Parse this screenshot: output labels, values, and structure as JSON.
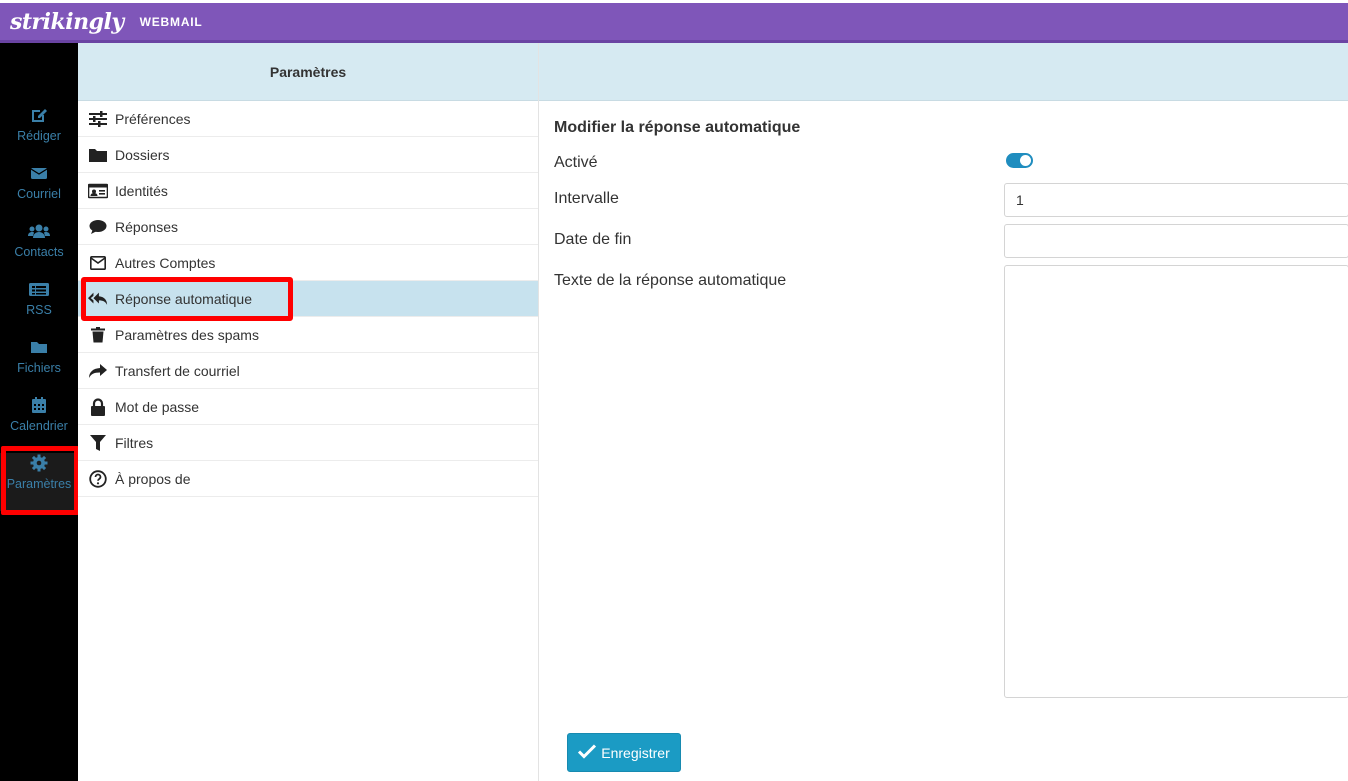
{
  "topbar": {
    "logo": "strikingly",
    "product": "WEBMAIL"
  },
  "nav": {
    "items": [
      {
        "label": "Rédiger",
        "icon": "compose-icon"
      },
      {
        "label": "Courriel",
        "icon": "envelope-icon"
      },
      {
        "label": "Contacts",
        "icon": "users-icon"
      },
      {
        "label": "RSS",
        "icon": "rss-list-icon"
      },
      {
        "label": "Fichiers",
        "icon": "folder-icon"
      },
      {
        "label": "Calendrier",
        "icon": "calendar-icon"
      },
      {
        "label": "Paramètres",
        "icon": "gear-icon"
      }
    ]
  },
  "settings": {
    "header": "Paramètres",
    "items": [
      {
        "label": "Préférences",
        "icon": "sliders-icon"
      },
      {
        "label": "Dossiers",
        "icon": "folder-icon"
      },
      {
        "label": "Identités",
        "icon": "id-card-icon"
      },
      {
        "label": "Réponses",
        "icon": "comment-icon"
      },
      {
        "label": "Autres Comptes",
        "icon": "envelope-square-icon"
      },
      {
        "label": "Réponse automatique",
        "icon": "reply-all-icon"
      },
      {
        "label": "Paramètres des spams",
        "icon": "trash-icon"
      },
      {
        "label": "Transfert de courriel",
        "icon": "share-icon"
      },
      {
        "label": "Mot de passe",
        "icon": "lock-icon"
      },
      {
        "label": "Filtres",
        "icon": "filter-icon"
      },
      {
        "label": "À propos de",
        "icon": "question-circle-icon"
      }
    ],
    "selected_index": 5
  },
  "form": {
    "title": "Modifier la réponse automatique",
    "active_label": "Activé",
    "active_value": true,
    "interval_label": "Intervalle",
    "interval_value": "1",
    "end_date_label": "Date de fin",
    "end_date_value": "",
    "text_label": "Texte de la réponse automatique",
    "text_value": "",
    "save_label": "Enregistrer"
  },
  "colors": {
    "topbar": "#7f56b9",
    "nav_bg": "#000000",
    "nav_text": "#3a7fa8",
    "header_bg": "#d6eaf2",
    "selected_bg": "#c7e2ee",
    "accent": "#1b9bc4",
    "highlight": "#ff0000"
  }
}
